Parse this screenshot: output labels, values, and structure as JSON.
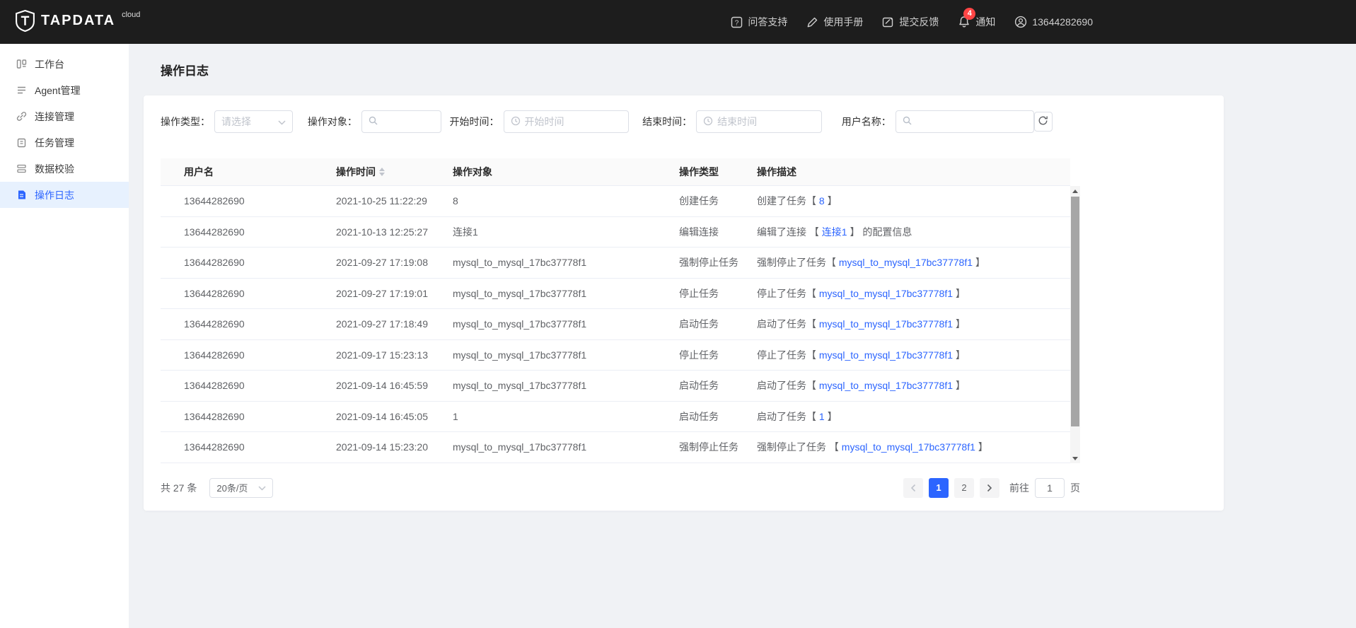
{
  "topbar": {
    "brand": "TAPDATA",
    "brand_sub": "cloud",
    "menu": [
      {
        "label": "问答支持"
      },
      {
        "label": "使用手册"
      },
      {
        "label": "提交反馈"
      },
      {
        "label": "通知",
        "badge": "4"
      },
      {
        "label": "13644282690"
      }
    ]
  },
  "sidebar": {
    "items": [
      {
        "label": "工作台"
      },
      {
        "label": "Agent管理"
      },
      {
        "label": "连接管理"
      },
      {
        "label": "任务管理"
      },
      {
        "label": "数据校验"
      },
      {
        "label": "操作日志"
      }
    ],
    "active_label": "操作日志"
  },
  "page": {
    "title": "操作日志"
  },
  "filters": {
    "type": {
      "label": "操作类型：",
      "placeholder": "请选择"
    },
    "object": {
      "label": "操作对象："
    },
    "start": {
      "label": "开始时间：",
      "placeholder": "开始时间"
    },
    "end": {
      "label": "结束时间：",
      "placeholder": "结束时间"
    },
    "user": {
      "label": "用户名称："
    }
  },
  "table": {
    "columns": {
      "user": "用户名",
      "time": "操作时间",
      "object": "操作对象",
      "type": "操作类型",
      "desc": "操作描述"
    },
    "rows": [
      {
        "user": "13644282690",
        "time": "2021-10-25 11:22:29",
        "object": "8",
        "type": "创建任务",
        "desc_prefix": "创建了任务【 ",
        "desc_link": "8",
        "desc_suffix": " 】"
      },
      {
        "user": "13644282690",
        "time": "2021-10-13 12:25:27",
        "object": "连接1",
        "type": "编辑连接",
        "desc_prefix": "编辑了连接 【 ",
        "desc_link": "连接1",
        "desc_suffix": " 】 的配置信息"
      },
      {
        "user": "13644282690",
        "time": "2021-09-27 17:19:08",
        "object": "mysql_to_mysql_17bc37778f1",
        "type": "强制停止任务",
        "desc_prefix": "强制停止了任务【 ",
        "desc_link": "mysql_to_mysql_17bc37778f1",
        "desc_suffix": " 】"
      },
      {
        "user": "13644282690",
        "time": "2021-09-27 17:19:01",
        "object": "mysql_to_mysql_17bc37778f1",
        "type": "停止任务",
        "desc_prefix": "停止了任务【 ",
        "desc_link": "mysql_to_mysql_17bc37778f1",
        "desc_suffix": " 】"
      },
      {
        "user": "13644282690",
        "time": "2021-09-27 17:18:49",
        "object": "mysql_to_mysql_17bc37778f1",
        "type": "启动任务",
        "desc_prefix": "启动了任务【 ",
        "desc_link": "mysql_to_mysql_17bc37778f1",
        "desc_suffix": " 】"
      },
      {
        "user": "13644282690",
        "time": "2021-09-17 15:23:13",
        "object": "mysql_to_mysql_17bc37778f1",
        "type": "停止任务",
        "desc_prefix": "停止了任务【 ",
        "desc_link": "mysql_to_mysql_17bc37778f1",
        "desc_suffix": " 】"
      },
      {
        "user": "13644282690",
        "time": "2021-09-14 16:45:59",
        "object": "mysql_to_mysql_17bc37778f1",
        "type": "启动任务",
        "desc_prefix": "启动了任务【 ",
        "desc_link": "mysql_to_mysql_17bc37778f1",
        "desc_suffix": " 】"
      },
      {
        "user": "13644282690",
        "time": "2021-09-14 16:45:05",
        "object": "1",
        "type": "启动任务",
        "desc_prefix": "启动了任务【 ",
        "desc_link": "1",
        "desc_suffix": " 】"
      },
      {
        "user": "13644282690",
        "time": "2021-09-14 15:23:20",
        "object": "mysql_to_mysql_17bc37778f1",
        "type": "强制停止任务",
        "desc_prefix": "强制停止了任务 【 ",
        "desc_link": "mysql_to_mysql_17bc37778f1",
        "desc_suffix": " 】"
      }
    ]
  },
  "pagination": {
    "total": "共 27 条",
    "page_size": "20条/页",
    "pages": [
      "1",
      "2"
    ],
    "active_page": "1",
    "goto_label": "前往",
    "goto_value": "1",
    "goto_unit": "页"
  },
  "colors": {
    "accent": "#2c65ff",
    "badge": "#ff4545",
    "topbar_bg": "#1d1d1d"
  }
}
